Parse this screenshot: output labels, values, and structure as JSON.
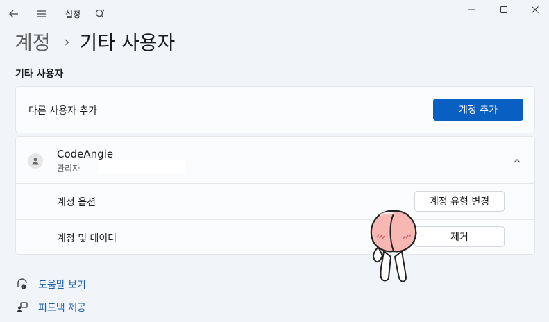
{
  "window": {
    "app_title": "설정",
    "icons": {
      "back": "back-arrow-icon",
      "menu": "hamburger-menu-icon",
      "app": "settings-app-icon",
      "minimize": "minimize-icon",
      "maximize": "maximize-icon",
      "close": "close-icon"
    }
  },
  "breadcrumb": {
    "parent": "계정",
    "separator": "›",
    "current": "기타 사용자"
  },
  "section": {
    "title": "기타 사용자"
  },
  "add_user": {
    "label": "다른 사용자 추가",
    "button": "계정 추가",
    "button_color": "#0a5fc2"
  },
  "user": {
    "name": "CodeAngie",
    "role": "관리자",
    "expanded": true,
    "options": [
      {
        "label": "계정 옵션",
        "button": "계정 유형 변경"
      },
      {
        "label": "계정 및 데이터",
        "button": "제거"
      }
    ]
  },
  "links": [
    {
      "label": "도움말 보기",
      "icon": "help-icon"
    },
    {
      "label": "피드백 제공",
      "icon": "feedback-icon"
    }
  ],
  "decoration": {
    "sticker": "peach-character-sticker"
  }
}
